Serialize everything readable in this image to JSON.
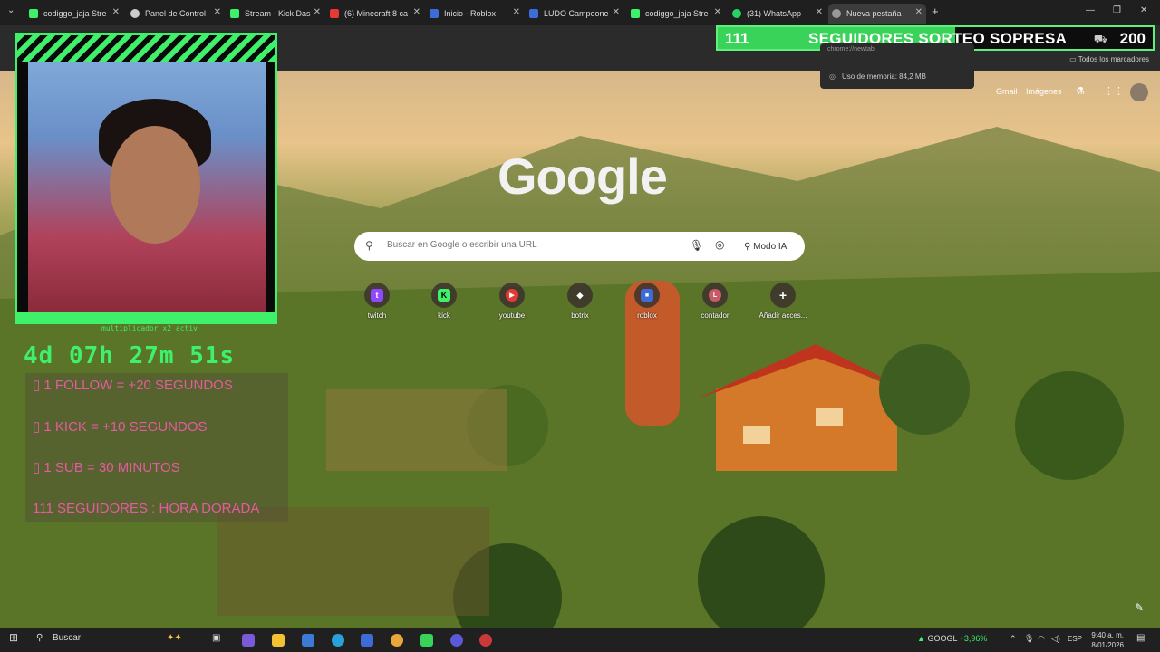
{
  "browser": {
    "tabs": [
      {
        "label": "codiggo_jaja Stre",
        "icon_color": "#3ef06a"
      },
      {
        "label": "Panel de Control",
        "icon_color": "#cccccc"
      },
      {
        "label": "Stream - Kick Das",
        "icon_color": "#3ef06a"
      },
      {
        "label": "(6) Minecraft 8 ca",
        "icon_color": "#e53935"
      },
      {
        "label": "Inicio - Roblox",
        "icon_color": "#3d6bd8"
      },
      {
        "label": "LUDO Campeone",
        "icon_color": "#3d6bd8"
      },
      {
        "label": "codiggo_jaja Stre",
        "icon_color": "#3ef06a"
      },
      {
        "label": "(31) WhatsApp",
        "icon_color": "#25d366"
      },
      {
        "label": "Nueva pestaña",
        "icon_color": "#999999"
      }
    ],
    "bookmarks_label": "Todos los marcadores",
    "memory_tooltip": {
      "url": "chrome://newtab",
      "memory": "Uso de memoria: 84,2 MB"
    }
  },
  "overlay_banner": {
    "count": "111",
    "text": "SEGUIDORES SORTEO SOPRESA",
    "goal": "200"
  },
  "google": {
    "logo": "Google",
    "links": [
      "Gmail",
      "Imágenes"
    ],
    "search_placeholder": "Buscar en Google o escribir una URL",
    "ai_mode": "Modo IA",
    "shortcuts": [
      {
        "label": "twitch",
        "icon_color": "#9146ff",
        "glyph": "t"
      },
      {
        "label": "kick",
        "icon_color": "#3ef06a",
        "glyph": "K"
      },
      {
        "label": "youtube",
        "icon_color": "#e53935",
        "glyph": "▶"
      },
      {
        "label": "botrix",
        "icon_color": "#ffffff",
        "glyph": "◆"
      },
      {
        "label": "roblox",
        "icon_color": "#3d6bd8",
        "glyph": "■"
      },
      {
        "label": "contador",
        "icon_color": "#c85a6a",
        "glyph": "L"
      },
      {
        "label": "Añadir acces...",
        "icon_color": "transparent",
        "glyph": "+"
      }
    ]
  },
  "stream_overlay": {
    "multiplier": "multiplicador x2 activ",
    "timer": "4d 07h 27m 51s",
    "rules": [
      "▯ 1 FOLLOW = +20 SEGUNDOS",
      "▯ 1 KICK  = +10 SEGUNDOS",
      "▯ 1 SUB = 30 MINUTOS",
      "111 SEGUIDORES : HORA DORADA"
    ]
  },
  "taskbar": {
    "search": "Buscar",
    "stock_name": "GOOGL",
    "stock_change": "+3,96%",
    "lang": "ESP",
    "time": "9:40 a. m.",
    "date": "8/01/2026"
  }
}
